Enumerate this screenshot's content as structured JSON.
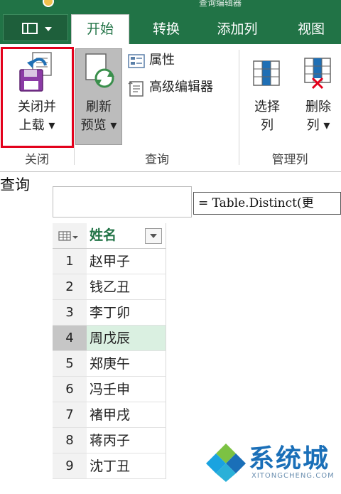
{
  "window": {
    "title": "查询编辑器"
  },
  "tabs": [
    {
      "label": "开始",
      "active": true
    },
    {
      "label": "转换",
      "active": false
    },
    {
      "label": "添加列",
      "active": false
    },
    {
      "label": "视图",
      "active": false
    }
  ],
  "ribbon": {
    "close_group": {
      "label": "关闭",
      "close_load": {
        "line1": "关闭并",
        "line2": "上载 ▾"
      }
    },
    "query_group": {
      "label": "查询",
      "refresh": {
        "line1": "刷新",
        "line2": "预览 ▾"
      },
      "properties": "属性",
      "advanced_editor": "高级编辑器"
    },
    "manage_group": {
      "label": "管理列",
      "choose_columns": {
        "line1": "选择",
        "line2": "列"
      },
      "remove_columns": {
        "line1": "删除",
        "line2": "列 ▾"
      }
    }
  },
  "query_pane": {
    "label": "查询"
  },
  "formula_bar": {
    "text": "= Table.Distinct(更"
  },
  "grid": {
    "column_header": "姓名",
    "rows": [
      {
        "num": "1",
        "value": "赵甲子"
      },
      {
        "num": "2",
        "value": "钱乙丑"
      },
      {
        "num": "3",
        "value": "李丁卯"
      },
      {
        "num": "4",
        "value": "周戊辰",
        "selected": true
      },
      {
        "num": "5",
        "value": "郑庚午"
      },
      {
        "num": "6",
        "value": "冯壬申"
      },
      {
        "num": "7",
        "value": "褚甲戌"
      },
      {
        "num": "8",
        "value": "蒋丙子"
      },
      {
        "num": "9",
        "value": "沈丁丑"
      }
    ]
  },
  "watermark": {
    "brand": "系统城",
    "site": "XITONGCHENG.COM"
  },
  "colors": {
    "accent": "#217346",
    "highlight_border": "#e3001b",
    "selected_row": "#daf0e1"
  }
}
